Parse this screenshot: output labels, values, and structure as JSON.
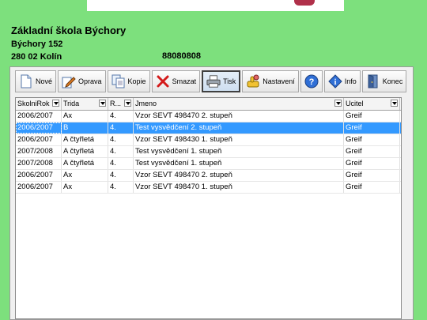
{
  "header": {
    "school_name": "Základní škola Býchory",
    "address_line1": "Býchory 152",
    "address_line2": "280 02 Kolín",
    "code": "88080808"
  },
  "toolbar": {
    "new_label": "Nové",
    "edit_label": "Oprava",
    "copy_label": "Kopie",
    "delete_label": "Smazat",
    "print_label": "Tisk",
    "settings_label": "Nastavení",
    "info_label": "Info",
    "end_label": "Konec"
  },
  "table": {
    "columns": [
      "SkolniRok",
      "Trida",
      "R...",
      "Jmeno",
      "Ucitel"
    ],
    "rows": [
      [
        "2006/2007",
        "Ax",
        "4.",
        "Vzor SEVT 498470 2. stupeň",
        "Greif"
      ],
      [
        "2006/2007",
        "B",
        "4.",
        "Test vysvědčení 2. stupeň",
        "Greif"
      ],
      [
        "2006/2007",
        "A čtyřletá",
        "4.",
        "Vzor SEVT 498430 1. stupeň",
        "Greif"
      ],
      [
        "2007/2008",
        "A čtyřletá",
        "4.",
        "Test vysvědčení 1. stupeň",
        "Greif"
      ],
      [
        "2007/2008",
        "A čtyřletá",
        "4.",
        "Test vysvědčení 1. stupeň",
        "Greif"
      ],
      [
        "2006/2007",
        "Ax",
        "4.",
        "Vzor SEVT 498470 2. stupeň",
        "Greif"
      ],
      [
        "2006/2007",
        "Ax",
        "4.",
        "Vzor SEVT 498470 1. stupeň",
        "Greif"
      ]
    ],
    "selected_row": 1
  },
  "colors": {
    "background": "#7de07d",
    "selection": "#3399ff"
  }
}
